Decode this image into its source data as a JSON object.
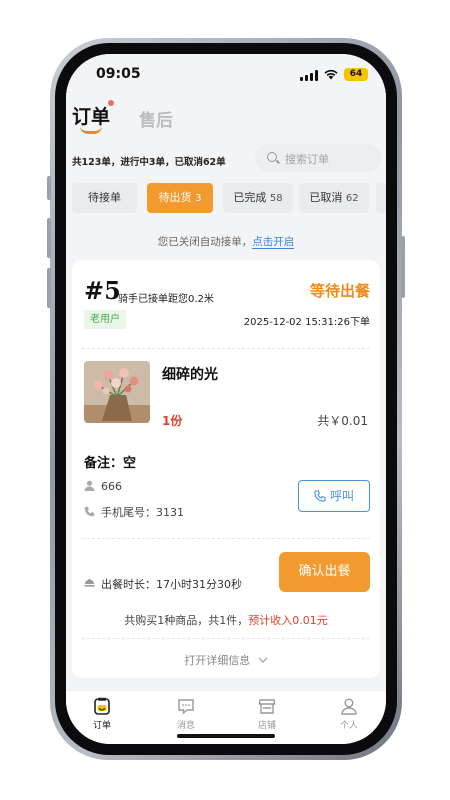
{
  "status_bar": {
    "time": "09:05",
    "battery": "64"
  },
  "header": {
    "tab_orders": "订单",
    "tab_aftersale": "售后"
  },
  "summary": "共123单，进行中3单，已取消62单",
  "search": {
    "placeholder": "搜索订单"
  },
  "filters": [
    {
      "label": "待接单",
      "count": ""
    },
    {
      "label": "待出货",
      "count": "3"
    },
    {
      "label": "已完成",
      "count": "58"
    },
    {
      "label": "已取消",
      "count": "62"
    }
  ],
  "active_filter_index": 1,
  "auto_accept": {
    "text": "您已关闭自动接单，",
    "link": "点击开启"
  },
  "order": {
    "number": "#5",
    "rider_text": "骑手已接单距您0.2米",
    "status": "等待出餐",
    "badge": "老用户",
    "time": "2025-12-02 15:31:26下单",
    "product_name": "细碎的光",
    "product_qty": "1份",
    "product_total": "共￥0.01",
    "remark": "备注：空",
    "customer_name": "666",
    "phone_tail": "手机尾号：3131",
    "call_label": "呼叫",
    "cook_time": "出餐时长：17小时31分30秒",
    "confirm_label": "确认出餐",
    "buy_summary": "共购买1种商品，共1件，",
    "income": "预计收入0.01元",
    "expand_label": "打开详细信息"
  },
  "bottom_nav": [
    {
      "label": "订单",
      "icon": "order-icon"
    },
    {
      "label": "消息",
      "icon": "message-icon"
    },
    {
      "label": "店铺",
      "icon": "store-icon"
    },
    {
      "label": "个人",
      "icon": "person-icon"
    }
  ],
  "colors": {
    "accent": "#f39a2e",
    "link": "#3b82d6",
    "price": "#e0402f",
    "badge": "#4caa4a"
  }
}
